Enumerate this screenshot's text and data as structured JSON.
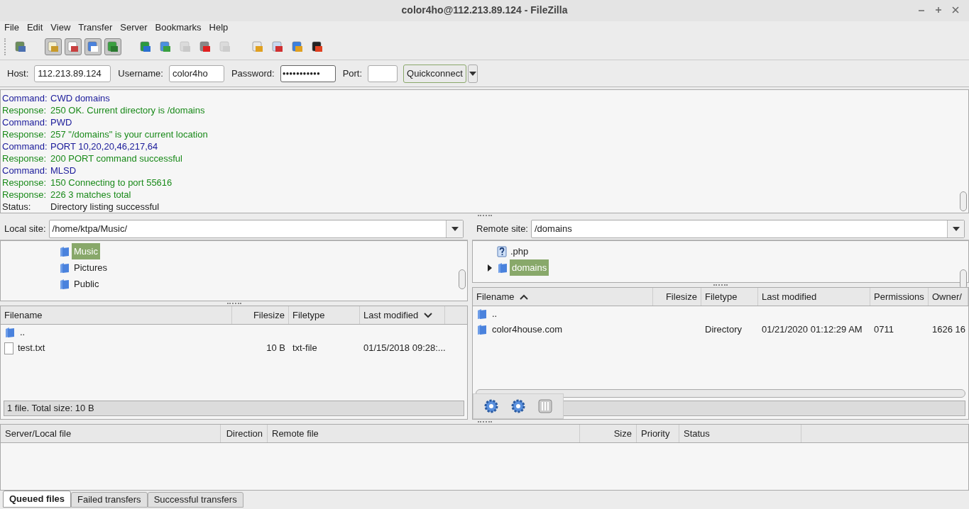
{
  "window": {
    "title": "color4ho@112.213.89.124 - FileZilla"
  },
  "menu": [
    "File",
    "Edit",
    "View",
    "Transfer",
    "Server",
    "Bookmarks",
    "Help"
  ],
  "toolbar": [
    {
      "kind": "button",
      "disabled": false
    },
    {
      "kind": "separator"
    },
    {
      "kind": "toggle",
      "on": true
    },
    {
      "kind": "toggle",
      "on": true
    },
    {
      "kind": "toggle",
      "on": true
    },
    {
      "kind": "toggle",
      "on": true
    },
    {
      "kind": "separator"
    },
    {
      "kind": "button",
      "disabled": false
    },
    {
      "kind": "button",
      "disabled": false
    },
    {
      "kind": "button",
      "disabled": true
    },
    {
      "kind": "button",
      "disabled": false
    },
    {
      "kind": "button",
      "disabled": true
    },
    {
      "kind": "separator"
    },
    {
      "kind": "button",
      "disabled": false
    },
    {
      "kind": "button",
      "disabled": false
    },
    {
      "kind": "button",
      "disabled": false
    },
    {
      "kind": "button",
      "disabled": false
    }
  ],
  "quickconnect": {
    "host_label": "Host:",
    "host": "112.213.89.124",
    "username_label": "Username:",
    "username": "color4ho",
    "password_label": "Password:",
    "password": "●●●●●●●●●●●",
    "port_label": "Port:",
    "button": "Quickconnect"
  },
  "log": [
    {
      "kind": "command",
      "label": "Command:",
      "text": "CWD domains"
    },
    {
      "kind": "response",
      "label": "Response:",
      "text": "250 OK. Current directory is /domains"
    },
    {
      "kind": "command",
      "label": "Command:",
      "text": "PWD"
    },
    {
      "kind": "response",
      "label": "Response:",
      "text": "257 \"/domains\" is your current location"
    },
    {
      "kind": "command",
      "label": "Command:",
      "text": "PORT 10,20,20,46,217,64"
    },
    {
      "kind": "response",
      "label": "Response:",
      "text": "200 PORT command successful"
    },
    {
      "kind": "command",
      "label": "Command:",
      "text": "MLSD"
    },
    {
      "kind": "response",
      "label": "Response:",
      "text": "150 Connecting to port 55616"
    },
    {
      "kind": "response",
      "label": "Response:",
      "text": "226 3 matches total"
    },
    {
      "kind": "status",
      "label": "Status:",
      "text": "Directory listing successful"
    }
  ],
  "local": {
    "site_label": "Local site:",
    "path": "/home/ktpa/Music/",
    "tree": [
      {
        "name": "Music",
        "kind": "folder",
        "selected": true,
        "expandable": false
      },
      {
        "name": "Pictures",
        "kind": "folder",
        "selected": false,
        "expandable": false
      },
      {
        "name": "Public",
        "kind": "folder",
        "selected": false,
        "expandable": false
      }
    ],
    "columns": [
      {
        "label": "Filename",
        "sorted": false
      },
      {
        "label": "Filesize",
        "sorted": false
      },
      {
        "label": "Filetype",
        "sorted": false
      },
      {
        "label": "Last modified",
        "sorted": true,
        "descending": true
      }
    ],
    "rows": [
      {
        "kind": "folder",
        "cells": [
          "..",
          "",
          "",
          ""
        ]
      },
      {
        "kind": "file",
        "cells": [
          "test.txt",
          "10 B",
          "txt-file",
          "01/15/2018 09:28:..."
        ]
      }
    ],
    "status": "1 file. Total size: 10 B"
  },
  "remote": {
    "site_label": "Remote site:",
    "path": "/domains",
    "tree": [
      {
        "name": ".php",
        "kind": "unknown",
        "selected": false,
        "expandable": false
      },
      {
        "name": "domains",
        "kind": "folder",
        "selected": true,
        "expandable": true
      }
    ],
    "columns": [
      {
        "label": "Filename",
        "sorted": true,
        "descending": false
      },
      {
        "label": "Filesize",
        "sorted": false
      },
      {
        "label": "Filetype",
        "sorted": false
      },
      {
        "label": "Last modified",
        "sorted": false
      },
      {
        "label": "Permissions",
        "sorted": false
      },
      {
        "label": "Owner/",
        "sorted": false
      }
    ],
    "rows": [
      {
        "kind": "folder",
        "cells": [
          "..",
          "",
          "",
          "",
          "",
          ""
        ]
      },
      {
        "kind": "folder",
        "cells": [
          "color4house.com",
          "",
          "Directory",
          "01/21/2020 01:12:29 AM",
          "0711",
          "1626 16"
        ]
      }
    ]
  },
  "queue": {
    "columns": [
      "Server/Local file",
      "Direction",
      "Remote file",
      "Size",
      "Priority",
      "Status"
    ]
  },
  "tabs": [
    {
      "label": "Queued files",
      "selected": true
    },
    {
      "label": "Failed transfers",
      "selected": false
    },
    {
      "label": "Successful transfers",
      "selected": false
    }
  ]
}
